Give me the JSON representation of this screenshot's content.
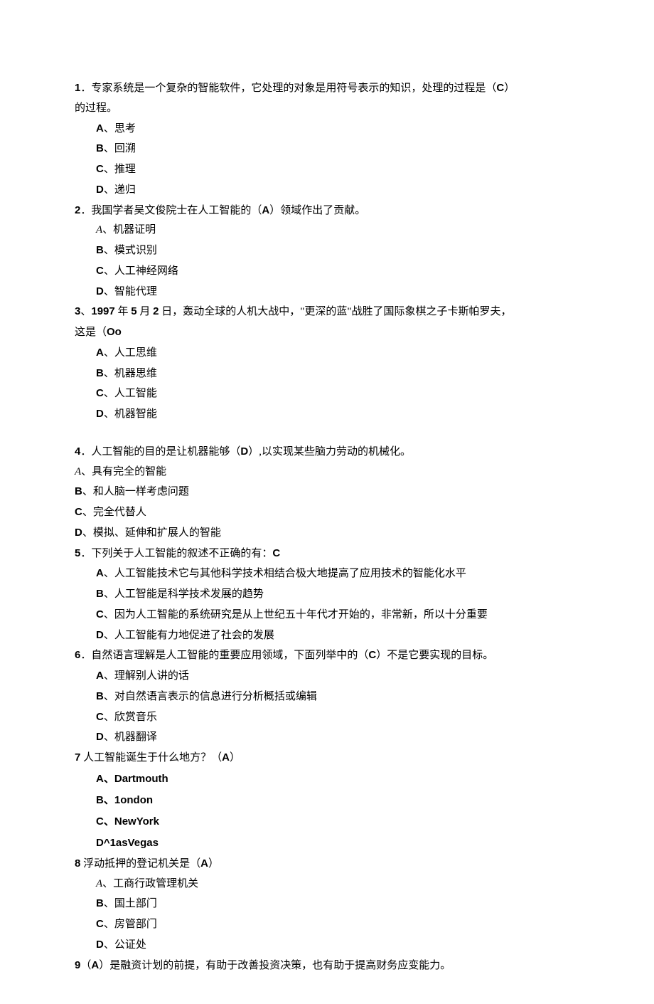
{
  "q1": {
    "number": "1",
    "stem_mid": "．专家系统是一个复杂的智能软件，它处理的对象是用符号表示的知识，处理的过程是（",
    "answer": "C",
    "stem_tail": "）",
    "cont": "的过程。",
    "options": {
      "A": "A",
      "At": "、思考",
      "B": "B",
      "Bt": "、回溯",
      "C": "C",
      "Ct": "、推理",
      "D": "D",
      "Dt": "、递归"
    }
  },
  "q2": {
    "number": "2",
    "stem_mid": "．我国学者吴文俊院士在人工智能的（",
    "answer": "A",
    "stem_tail": "）领域作出了贡献。",
    "options": {
      "A": "A",
      "At": "、机器证明",
      "B": "B",
      "Bt": "、模式识别",
      "C": "C",
      "Ct": "、人工神经网络",
      "D": "D",
      "Dt": "、智能代理"
    }
  },
  "q3": {
    "number": "3",
    "sep": "、",
    "year": "1997",
    "mid1": " 年 ",
    "month": "5",
    "mid2": " 月 ",
    "day": "2",
    "mid3": " 日，轰动全球的人机大战中，\"更深的蓝\"战胜了国际象棋之子卡斯帕罗夫，",
    "cont_pre": "这是（",
    "answer": "Oo",
    "options": {
      "A": "A",
      "At": "、人工思维",
      "B": "B",
      "Bt": "、机器思维",
      "C": "C",
      "Ct": "、人工智能",
      "D": "D",
      "Dt": "、机器智能"
    }
  },
  "q4": {
    "number": "4",
    "stem_mid": "．人工智能的目的是让机器能够（",
    "answer": "D",
    "stem_tail": "）,以实现某些脑力劳动的机械化。",
    "options": {
      "A": "A",
      "At": "、具有完全的智能",
      "B": "B",
      "Bt": "、和人脑一样考虑问题",
      "C": "C",
      "Ct": "、完全代替人",
      "D": "D",
      "Dt": "、模拟、延伸和扩展人的智能"
    }
  },
  "q5": {
    "number": "5",
    "stem_mid": "．下列关于人工智能的叙述不正确的有：",
    "answer": "C",
    "options": {
      "A": "A",
      "At": "、人工智能技术它与其他科学技术相结合极大地提高了应用技术的智能化水平",
      "B": "B",
      "Bt": "、人工智能是科学技术发展的趋势",
      "C": "C",
      "Ct": "、因为人工智能的系统研究是从上世纪五十年代才开始的，非常新，所以十分重要",
      "D": "D",
      "Dt": "、人工智能有力地促进了社会的发展"
    }
  },
  "q6": {
    "number": "6",
    "stem_mid": "．自然语言理解是人工智能的重要应用领域，下面列举中的（",
    "answer": "C",
    "stem_tail": "）不是它要实现的目标。",
    "options": {
      "A": "A",
      "At": "、理解别人讲的话",
      "B": "B",
      "Bt": "、对自然语言表示的信息进行分析概括或编辑",
      "C": "C",
      "Ct": "、欣赏音乐",
      "D": "D",
      "Dt": "、机器翻译"
    }
  },
  "q7": {
    "number": "7",
    "stem_mid": " 人工智能诞生于什么地方？（",
    "answer": "A",
    "stem_tail": "）",
    "options": {
      "A": "A",
      "Asep": "、",
      "At": "Dartmouth",
      "B": "B",
      "Bsep": "、",
      "Bt": "1ondon",
      "C": "C",
      "Csep": "、",
      "Ct": "NewYork",
      "D": "D^1asVegas"
    }
  },
  "q8": {
    "number": "8",
    "stem_mid": " 浮动抵押的登记机关是（",
    "answer": "A",
    "stem_tail": "）",
    "options": {
      "A": "A",
      "At": "、工商行政管理机关",
      "B": "B",
      "Bt": "、国土部门",
      "C": "C",
      "Ct": "、房管部门",
      "D": "D",
      "Dt": "、公证处"
    }
  },
  "q9": {
    "number": "9",
    "stem_pre": "（",
    "answer": "A",
    "stem_tail": "）是融资计划的前提，有助于改善投资决策，也有助于提高财务应变能力。"
  }
}
